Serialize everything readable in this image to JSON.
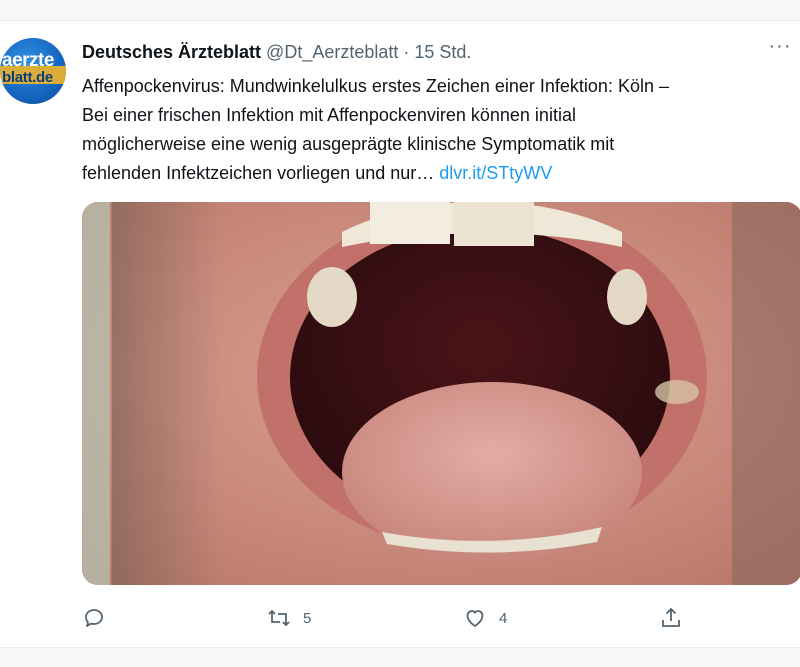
{
  "tweet": {
    "author_name": "Deutsches Ärzteblatt",
    "handle": "@Dt_Aerzteblatt",
    "separator": "·",
    "time": "15 Std.",
    "more_label": "···",
    "avatar_line1": "aerzte",
    "avatar_line2": "blatt.de",
    "text_lines": [
      "Affenpockenvirus: Mundwinkelulkus erstes Zeichen einer Infektion:  Köln –",
      "Bei einer frischen Infektion mit Affenpockenviren können initial",
      "möglicherweise eine wenig ausgeprägte klinische Symptomatik mit",
      "fehlenden Infektzeichen vorliegen und nur…"
    ],
    "link": "dlvr.it/STtyWV"
  },
  "actions": {
    "reply_icon": "reply-icon",
    "retweet_icon": "retweet-icon",
    "retweet_count": "5",
    "like_icon": "heart-icon",
    "like_count": "4",
    "share_icon": "share-icon"
  },
  "colors": {
    "link": "#1d9bf0",
    "muted": "#536471",
    "text": "#0f1419"
  }
}
